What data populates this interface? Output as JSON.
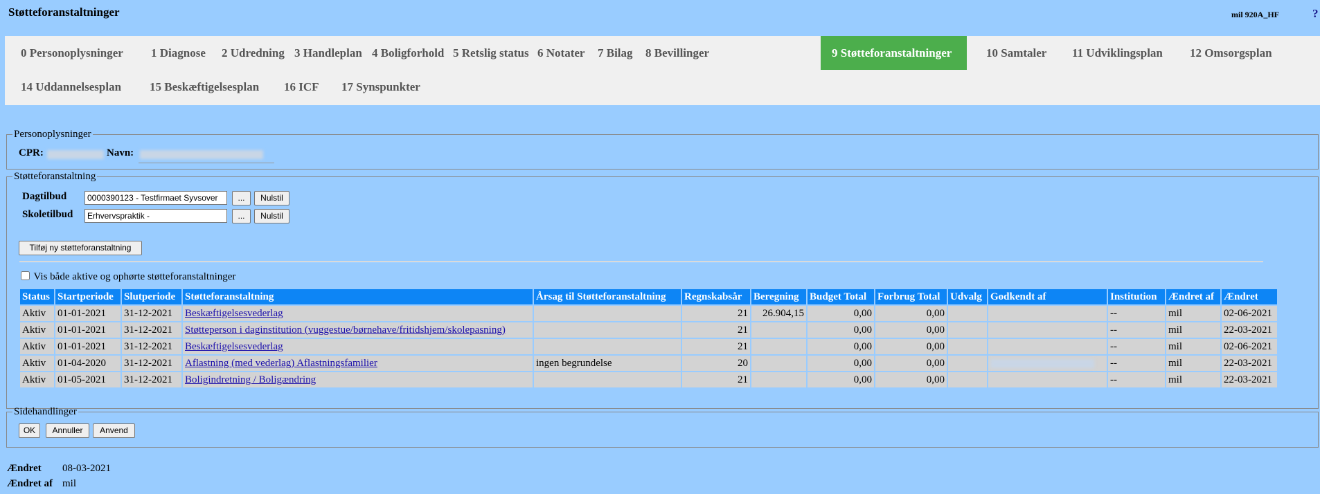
{
  "app": {
    "title": "Støtteforanstaltninger",
    "user": "mil 920A_HF",
    "help": "?"
  },
  "tabs": [
    {
      "label": "0 Personoplysninger",
      "active": false
    },
    {
      "label": "1 Diagnose",
      "active": false
    },
    {
      "label": "2 Udredning",
      "active": false
    },
    {
      "label": "3 Handleplan",
      "active": false
    },
    {
      "label": "4 Boligforhold",
      "active": false
    },
    {
      "label": "5 Retslig status",
      "active": false
    },
    {
      "label": "6 Notater",
      "active": false
    },
    {
      "label": "7 Bilag",
      "active": false
    },
    {
      "label": "8 Bevillinger",
      "active": false
    },
    {
      "label": "9 Støtteforanstaltninger",
      "active": true
    },
    {
      "label": "10 Samtaler",
      "active": false
    },
    {
      "label": "11 Udviklingsplan",
      "active": false
    },
    {
      "label": "12 Omsorgsplan",
      "active": false
    },
    {
      "label": "14 Uddannelsesplan",
      "active": false
    },
    {
      "label": "15 Beskæftigelsesplan",
      "active": false
    },
    {
      "label": "16 ICF",
      "active": false
    },
    {
      "label": "17 Synspunkter",
      "active": false
    }
  ],
  "person": {
    "legend": "Personoplysninger",
    "cpr_label": "CPR:",
    "navn_label": "Navn:"
  },
  "stotte": {
    "legend": "Støtteforanstaltning",
    "dagtilbud_label": "Dagtilbud",
    "dagtilbud_value": "0000390123 - Testfirmaet Syvsover",
    "skoletilbud_label": "Skoletilbud",
    "skoletilbud_value": "Erhvervspraktik -",
    "browse_label": "...",
    "reset_label": "Nulstil",
    "add_label": "Tilføj ny støtteforanstaltning",
    "show_all_label": "Vis både aktive og ophørte støtteforanstaltninger",
    "show_all_checked": false
  },
  "table": {
    "headers": [
      "Status",
      "Startperiode",
      "Slutperiode",
      "Støtteforanstaltning",
      "Årsag til Støtteforanstaltning",
      "Regnskabsår",
      "Beregning",
      "Budget Total",
      "Forbrug Total",
      "Udvalg",
      "Godkendt af",
      "Institution",
      "Ændret af",
      "Ændret"
    ],
    "rows": [
      [
        "Aktiv",
        "01-01-2021",
        "31-12-2021",
        "Beskæftigelsesvederlag",
        "",
        "21",
        "26.904,15",
        "0,00",
        "0,00",
        "",
        "",
        "--",
        "mil",
        "02-06-2021"
      ],
      [
        "Aktiv",
        "01-01-2021",
        "31-12-2021",
        "Støtteperson i daginstitution (vuggestue/børnehave/fritidshjem/skolepasning)",
        "",
        "21",
        "",
        "0,00",
        "0,00",
        "",
        "",
        "--",
        "mil",
        "22-03-2021"
      ],
      [
        "Aktiv",
        "01-01-2021",
        "31-12-2021",
        "Beskæftigelsesvederlag",
        "",
        "21",
        "",
        "0,00",
        "0,00",
        "",
        "",
        "--",
        "mil",
        "02-06-2021"
      ],
      [
        "Aktiv",
        "01-04-2020",
        "31-12-2021",
        "Aflastning (med vederlag) Aflastningsfamilier",
        "ingen begrundelse",
        "20",
        "",
        "0,00",
        "0,00",
        "",
        "",
        "--",
        "mil",
        "22-03-2021"
      ],
      [
        "Aktiv",
        "01-05-2021",
        "31-12-2021",
        "Boligindretning / Boligændring",
        "",
        "21",
        "",
        "0,00",
        "0,00",
        "",
        "",
        "--",
        "mil",
        "22-03-2021"
      ]
    ]
  },
  "side": {
    "legend": "Sidehandlinger",
    "ok": "OK",
    "cancel": "Annuller",
    "apply": "Anvend"
  },
  "footer": {
    "changed_label": "Ændret",
    "changed_value": "08-03-2021",
    "changed_by_label": "Ændret af",
    "changed_by_value": "mil"
  }
}
